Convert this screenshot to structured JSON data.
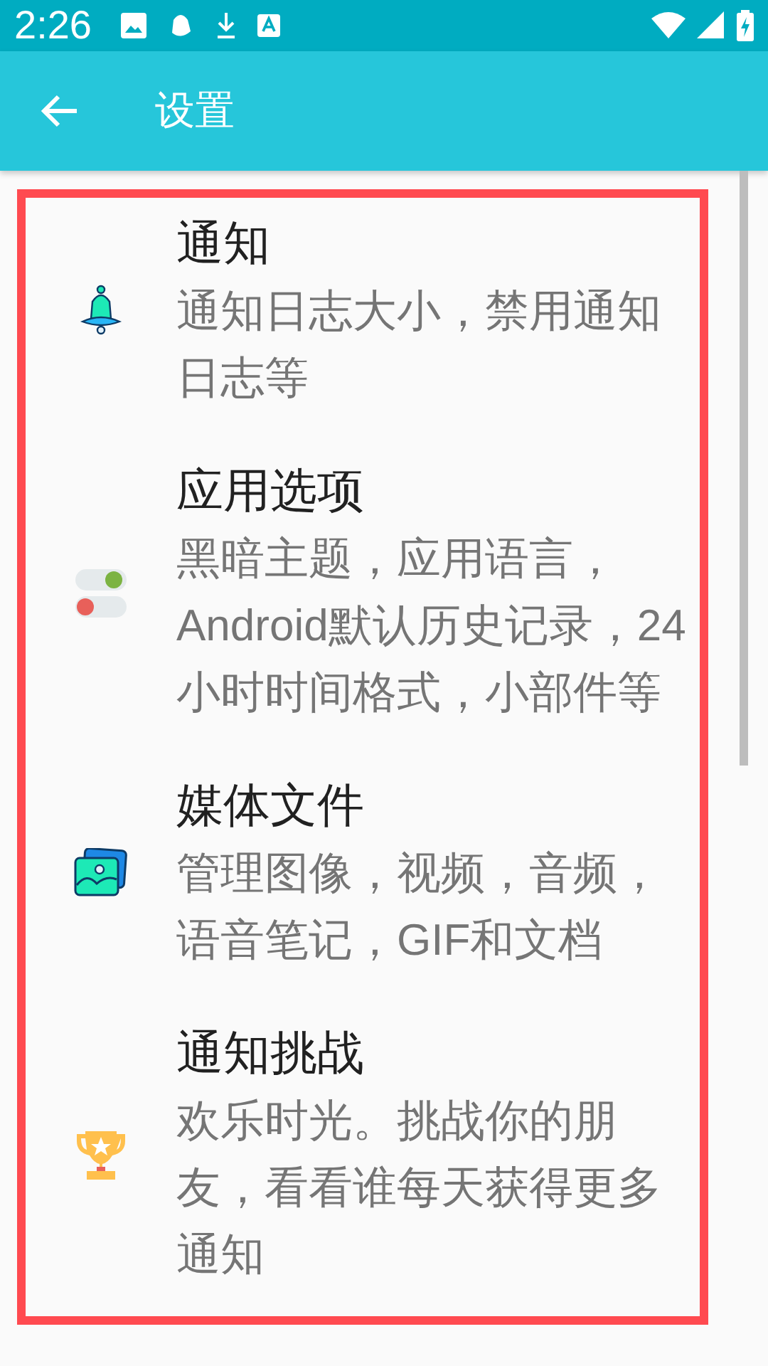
{
  "status_bar": {
    "time": "2:26"
  },
  "app_bar": {
    "title": "设置"
  },
  "settings": [
    {
      "kind": "bell",
      "title": "通知",
      "subtitle": "通知日志大小，禁用通知日志等"
    },
    {
      "kind": "toggles",
      "title": "应用选项",
      "subtitle": "黑暗主题，应用语言，Android默认历史记录，24小时时间格式，小部件等"
    },
    {
      "kind": "photos",
      "title": "媒体文件",
      "subtitle": "管理图像，视频，音频，语音笔记，GIF和文档"
    },
    {
      "kind": "trophy",
      "title": "通知挑战",
      "subtitle": "欢乐时光。挑战你的朋友，看看谁每天获得更多通知"
    }
  ]
}
